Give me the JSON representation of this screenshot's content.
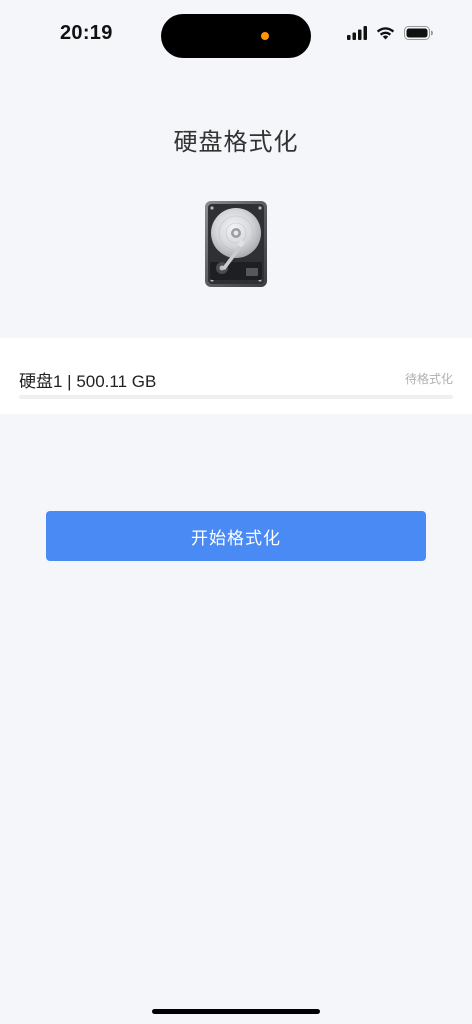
{
  "status_bar": {
    "time": "20:19",
    "icons": [
      "signal-icon",
      "wifi-icon",
      "battery-icon"
    ],
    "privacy_dot_color": "#ff9500"
  },
  "page": {
    "title": "硬盘格式化",
    "image": "hard-disk-drive"
  },
  "disk": {
    "name": "硬盘1 | 500.11 GB",
    "status": "待格式化",
    "progress": 0
  },
  "actions": {
    "start_label": "开始格式化"
  },
  "colors": {
    "accent": "#4a8af4",
    "background": "#f4f6f9",
    "card": "#ffffff",
    "muted_text": "#b0b0b0"
  }
}
